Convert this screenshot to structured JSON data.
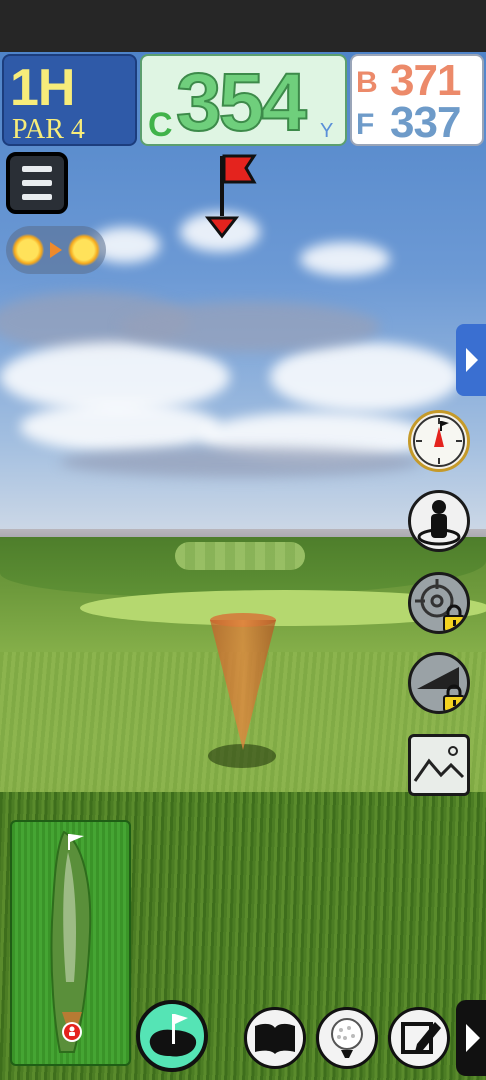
{
  "hole": {
    "number": "1H",
    "par": "PAR 4"
  },
  "distance": {
    "prefix": "C",
    "value": "354",
    "unit": "Y"
  },
  "back_front": {
    "back_letter": "B",
    "back_value": "371",
    "front_letter": "F",
    "front_value": "337"
  },
  "colors": {
    "hole_bg": "#2f5aa8",
    "hole_text": "#f7ec7a",
    "distance_bg": "#dff5e3",
    "distance_text": "#6fcf7c",
    "back_color": "#ec8a6a",
    "front_color": "#6e9bc9",
    "flag_red": "#e4231e",
    "hole_button_teal": "#55e4b5",
    "side_tab_blue": "#3a6fd1"
  },
  "icons": {
    "menu": "hamburger-icon",
    "weather_from": "sun-icon",
    "weather_to": "sun-icon",
    "weather_arrow": "arrow-right-icon",
    "target_flag": "flag-icon",
    "side_panel": "chevron-right-icon",
    "compass": "compass-icon",
    "player_view": "person-icon",
    "aim_lock": "crosshair-icon",
    "slope_lock": "slope-icon",
    "lock": "lock-icon",
    "photo": "image-icon",
    "hole_overview": "hole-flag-icon",
    "book": "book-icon",
    "ball": "golf-ball-icon",
    "edit": "pencil-icon",
    "next": "chevron-right-icon"
  },
  "controls": {
    "aim_locked": true,
    "slope_locked": true
  }
}
